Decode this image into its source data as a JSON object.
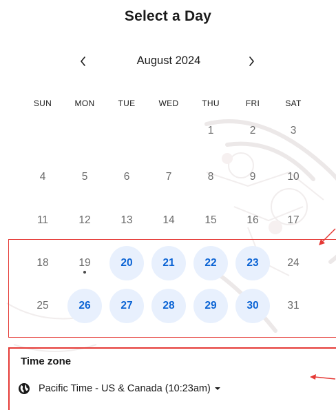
{
  "page": {
    "title": "Select a Day"
  },
  "calendar": {
    "month_label": "August 2024",
    "weekdays": [
      "SUN",
      "MON",
      "TUE",
      "WED",
      "THU",
      "FRI",
      "SAT"
    ],
    "weeks": [
      [
        null,
        null,
        null,
        null,
        {
          "d": "1"
        },
        {
          "d": "2"
        },
        {
          "d": "3"
        }
      ],
      [
        {
          "d": "4"
        },
        {
          "d": "5"
        },
        {
          "d": "6"
        },
        {
          "d": "7"
        },
        {
          "d": "8"
        },
        {
          "d": "9"
        },
        {
          "d": "10"
        }
      ],
      [
        {
          "d": "11"
        },
        {
          "d": "12"
        },
        {
          "d": "13"
        },
        {
          "d": "14"
        },
        {
          "d": "15"
        },
        {
          "d": "16"
        },
        {
          "d": "17"
        }
      ],
      [
        {
          "d": "18"
        },
        {
          "d": "19",
          "today": true
        },
        {
          "d": "20",
          "available": true
        },
        {
          "d": "21",
          "available": true
        },
        {
          "d": "22",
          "available": true
        },
        {
          "d": "23",
          "available": true
        },
        {
          "d": "24"
        }
      ],
      [
        {
          "d": "25"
        },
        {
          "d": "26",
          "available": true
        },
        {
          "d": "27",
          "available": true
        },
        {
          "d": "28",
          "available": true
        },
        {
          "d": "29",
          "available": true
        },
        {
          "d": "30",
          "available": true
        },
        {
          "d": "31"
        }
      ]
    ],
    "icons": {
      "prev": "chevron-left-icon",
      "next": "chevron-right-icon"
    }
  },
  "timezone": {
    "label": "Time zone",
    "value": "Pacific Time - US & Canada (10:23am)",
    "icons": {
      "globe": "globe-icon",
      "caret": "caret-down-icon"
    }
  },
  "colors": {
    "accent": "#0a63d4",
    "available_bg": "#e8f0fd",
    "annotation_red": "#e53935",
    "muted_text": "#6b6b6b"
  }
}
